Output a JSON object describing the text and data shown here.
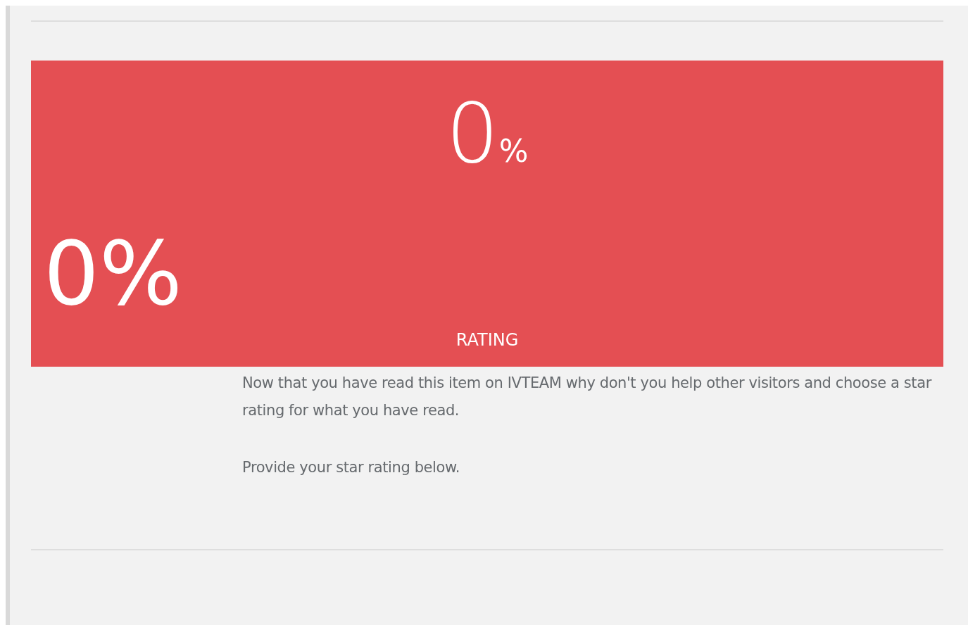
{
  "rating_panel": {
    "score": {
      "value": "0",
      "unit": "%"
    },
    "side_score": "0%",
    "label": "RATING"
  },
  "paragraphs": [
    "Now that you have read this item on IVTEAM why don't you help other visitors and choose a star rating for what you have read.",
    "Provide your star rating below."
  ]
}
